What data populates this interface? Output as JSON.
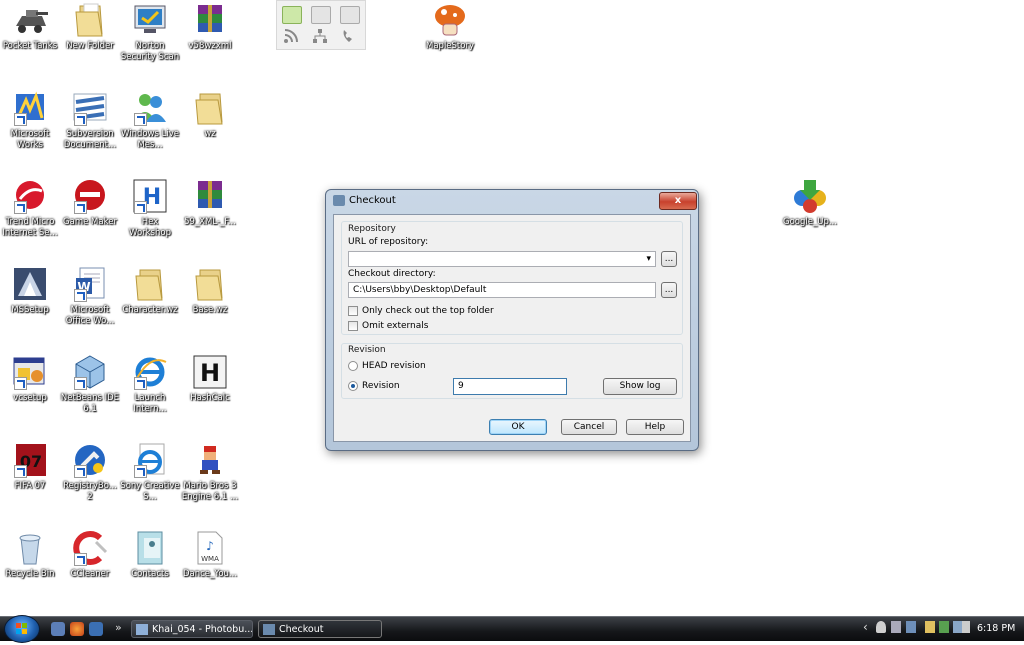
{
  "desktop": {
    "icons": [
      {
        "label": "Pocket Tanks"
      },
      {
        "label": "New Folder"
      },
      {
        "label": "Norton Security Scan"
      },
      {
        "label": "v58wzxml"
      },
      {
        "label": "Microsoft Works"
      },
      {
        "label": "Subversion Document..."
      },
      {
        "label": "Windows Live Mes..."
      },
      {
        "label": "wz"
      },
      {
        "label": "Trend Micro Internet Se..."
      },
      {
        "label": "Game Maker"
      },
      {
        "label": "Hex Workshop"
      },
      {
        "label": "59_XML-_F..."
      },
      {
        "label": "MSSetup"
      },
      {
        "label": "Microsoft Office Wo..."
      },
      {
        "label": "Character.wz"
      },
      {
        "label": "Base.wz"
      },
      {
        "label": "vcsetup"
      },
      {
        "label": "NetBeans IDE 6.1"
      },
      {
        "label": "Launch Intern..."
      },
      {
        "label": "HashCalc"
      },
      {
        "label": "FIFA 07"
      },
      {
        "label": "RegistryBo... 2"
      },
      {
        "label": "Sony Creative S..."
      },
      {
        "label": "Mario Bros 3 Engine 6.1 ..."
      },
      {
        "label": "Recycle Bin"
      },
      {
        "label": "CCleaner"
      },
      {
        "label": "Contacts"
      },
      {
        "label": "Dance_You..."
      },
      {
        "label": "MapleStory"
      },
      {
        "label": "Google_Up..."
      }
    ],
    "hashcalc_glyph": "H",
    "fifa_glyph": "07",
    "wma_glyph": "WMA"
  },
  "dialog": {
    "title": "Checkout",
    "close_glyph": "x",
    "repository_group": "Repository",
    "url_label": "URL of repository:",
    "url_value": "",
    "dropdown_glyph": "▾",
    "browse_label": "...",
    "dir_label": "Checkout directory:",
    "dir_value": "C:\\Users\\bby\\Desktop\\Default",
    "only_top_folder": "Only check out the top folder",
    "omit_externals": "Omit externals",
    "revision_group": "Revision",
    "head_revision": "HEAD revision",
    "revision": "Revision",
    "revision_value": "9",
    "show_log": "Show log",
    "ok": "OK",
    "cancel": "Cancel",
    "help": "Help"
  },
  "taskbar": {
    "overflow_glyph": "»",
    "windows": [
      {
        "label": "Khai_054 - Photobu..."
      },
      {
        "label": "Checkout"
      }
    ],
    "tray_chevron": "‹",
    "clock": "6:18 PM"
  }
}
